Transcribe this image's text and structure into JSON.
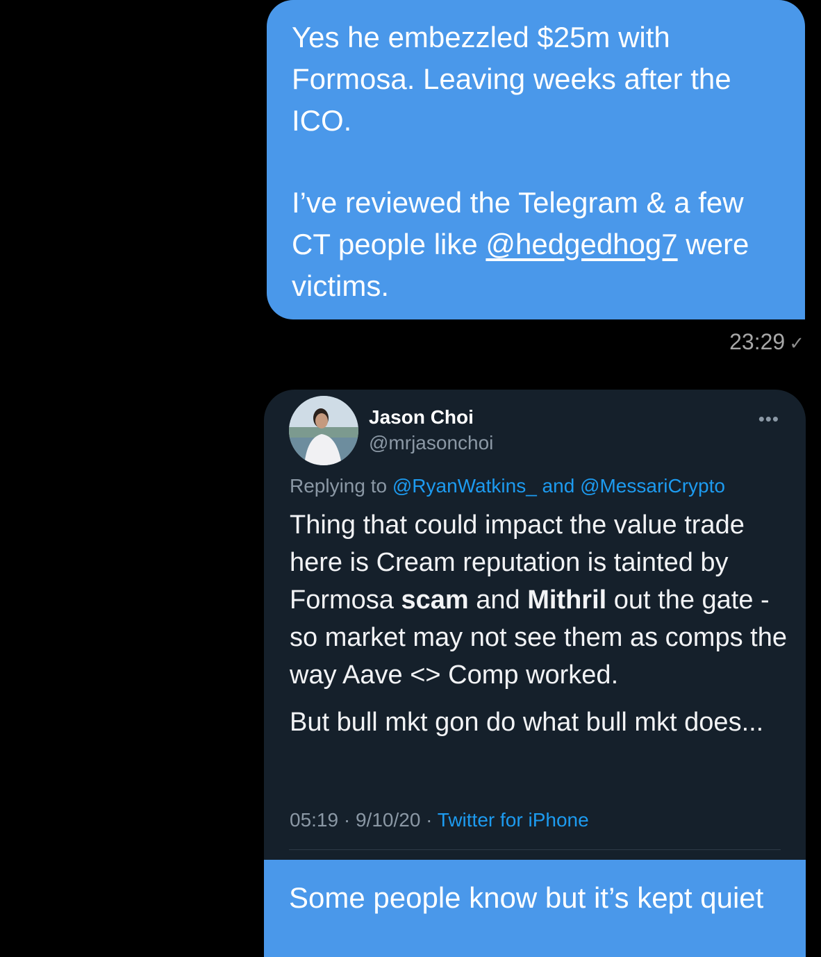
{
  "message_top": {
    "para1": "Yes he embezzled $25m with Formosa. Leaving weeks after the ICO.",
    "para2_before": "I’ve reviewed the Telegram & a few CT people like ",
    "para2_mention": "@hedgedhog7",
    "para2_after": " were victims.",
    "time": "23:29",
    "status_icon": "check-icon"
  },
  "tweet": {
    "author_name": "Jason Choi",
    "author_handle": "@mrjasonchoi",
    "more_icon": "ellipsis-icon",
    "reply_prefix": "Replying to ",
    "reply_user1": "@RyanWatkins_",
    "reply_and": " and ",
    "reply_user2": "@MessariCrypto",
    "text1_a": "Thing that could impact the value trade here is Cream reputation is tainted by Formosa ",
    "text1_b": "scam",
    "text1_c": " and ",
    "text1_d": "Mithril",
    "text1_e": " out the gate - so market may not see them as comps the way Aave <> Comp worked.",
    "text2": "But bull mkt gon do what bull mkt does...",
    "time": "05:19",
    "sep": " · ",
    "date": "9/10/20",
    "source": "Twitter for iPhone"
  },
  "message_bottom": {
    "text": "Some people know but it’s kept quiet"
  },
  "colors": {
    "bubble": "#4a98ea",
    "card": "#15202b",
    "link": "#1d9bf0",
    "muted": "#8b98a5",
    "background": "#000000"
  }
}
